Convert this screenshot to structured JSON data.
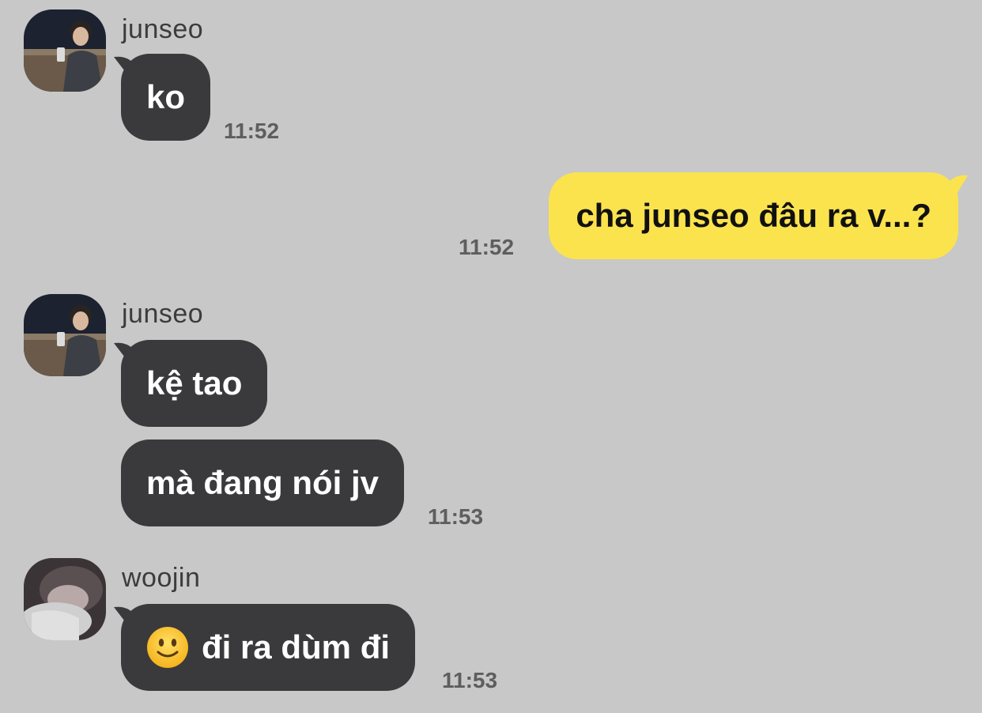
{
  "messages": [
    {
      "sender": "junseo",
      "text": "ko",
      "time": "11:52"
    },
    {
      "sender": "me",
      "text": "cha junseo đâu ra v...?",
      "time": "11:52"
    },
    {
      "sender": "junseo",
      "text": "kệ tao"
    },
    {
      "sender": "junseo",
      "text": "mà đang nói jv",
      "time": "11:53"
    },
    {
      "sender": "woojin",
      "emoji": "slightly-smiling-face-icon",
      "text": "đi ra dùm đi",
      "time": "11:53"
    }
  ],
  "colors": {
    "background": "#c8c8c8",
    "incoming_bubble": "#3a3a3c",
    "outgoing_bubble": "#fbe34e"
  }
}
